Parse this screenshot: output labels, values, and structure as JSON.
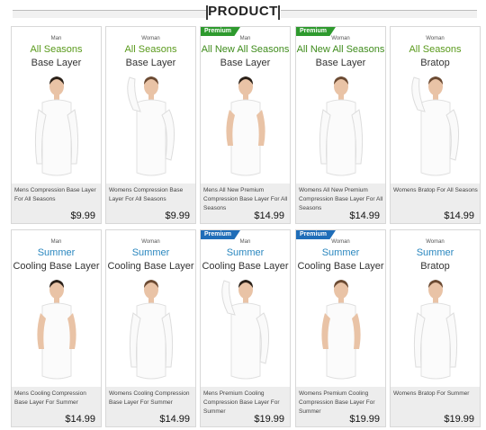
{
  "header": {
    "title": "PRODUCT"
  },
  "rows": [
    [
      {
        "gender": "Man",
        "line1": "All Seasons",
        "line1_color": "green",
        "line2": "Base Layer",
        "badge": "",
        "name": "Mens Compression Base Layer For All Seasons",
        "price": "$9.99"
      },
      {
        "gender": "Woman",
        "line1": "All Seasons",
        "line1_color": "green",
        "line2": "Base Layer",
        "badge": "",
        "name": "Womens Compression Base Layer For All Seasons",
        "price": "$9.99"
      },
      {
        "gender": "Man",
        "line1": "All New All Seasons",
        "line1_color": "green-dark",
        "line2": "Base Layer",
        "badge": "Premium",
        "badge_color": "#2e9a2e",
        "name": "Mens All New Premium Compression Base Layer For All Seasons",
        "price": "$14.99"
      },
      {
        "gender": "Woman",
        "line1": "All New All Seasons",
        "line1_color": "green-dark",
        "line2": "Base Layer",
        "badge": "Premium",
        "badge_color": "#2e9a2e",
        "name": "Womens All New Premium Compression Base Layer For All Seasons",
        "price": "$14.99"
      },
      {
        "gender": "Woman",
        "line1": "All Seasons",
        "line1_color": "green",
        "line2": "Bratop",
        "badge": "",
        "name": "Womens Bratop For All Seasons",
        "price": "$14.99"
      }
    ],
    [
      {
        "gender": "Man",
        "line1": "Summer",
        "line1_color": "blue",
        "line2": "Cooling Base Layer",
        "badge": "",
        "name": "Mens Cooling Compression Base Layer For Summer",
        "price": "$14.99"
      },
      {
        "gender": "Woman",
        "line1": "Summer",
        "line1_color": "blue",
        "line2": "Cooling Base Layer",
        "badge": "",
        "name": "Womens Cooling Compression Base Layer For Summer",
        "price": "$14.99"
      },
      {
        "gender": "Man",
        "line1": "Summer",
        "line1_color": "blue",
        "line2": "Cooling Base Layer",
        "badge": "Premium",
        "badge_color": "#1f6db8",
        "name": "Mens Premium Cooling Compression Base Layer For Summer",
        "price": "$19.99"
      },
      {
        "gender": "Woman",
        "line1": "Summer",
        "line1_color": "blue",
        "line2": "Cooling Base Layer",
        "badge": "Premium",
        "badge_color": "#1f6db8",
        "name": "Womens Premium Cooling Compression Base Layer For Summer",
        "price": "$19.99"
      },
      {
        "gender": "Woman",
        "line1": "Summer",
        "line1_color": "blue",
        "line2": "Bratop",
        "badge": "",
        "name": "Womens Bratop For Summer",
        "price": "$19.99"
      }
    ]
  ],
  "colors": {
    "green": "#5a9a1c",
    "green_dark": "#3f8c1c",
    "blue": "#2a87bf",
    "info_bg": "#ededed"
  }
}
